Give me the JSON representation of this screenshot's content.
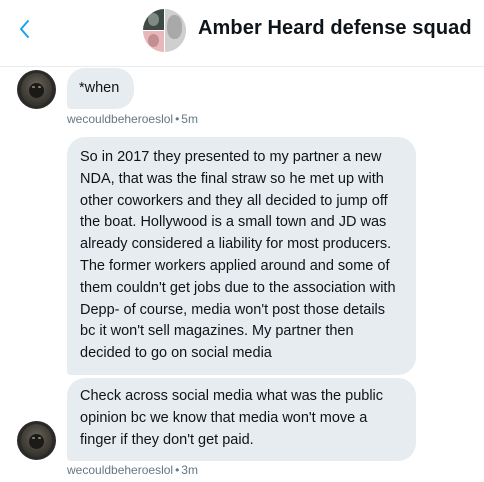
{
  "header": {
    "title": "Amber Heard defense squad",
    "back_icon": "chevron-left-icon",
    "accent_color": "#1da1f2"
  },
  "messages": [
    {
      "lines": [
        "*when"
      ],
      "sender": "wecouldbeheroeslol",
      "separator": "•",
      "time": "5m"
    },
    {
      "lines": [
        "So in 2017 they presented to my partner a new",
        "NDA, that was the final straw so he met up with",
        "other coworkers and they all decided to jump off",
        "the boat. Hollywood is a small town and JD was",
        "already considered a liability for most producers.",
        "The former workers applied around and some of",
        "them couldn't get jobs due to the association with",
        "Depp- of course, media won't post those details",
        "bc it won't sell magazines. My partner then",
        "decided to go on social media"
      ]
    },
    {
      "lines": [
        "Check across social media what was the public",
        "opinion bc we know that media won't move a",
        "finger if they don't get paid."
      ],
      "sender": "wecouldbeheroeslol",
      "separator": "•",
      "time": "3m"
    }
  ],
  "colors": {
    "bubble_bg": "#e6ecf0",
    "text": "#0f1419",
    "meta_text": "#657786"
  }
}
